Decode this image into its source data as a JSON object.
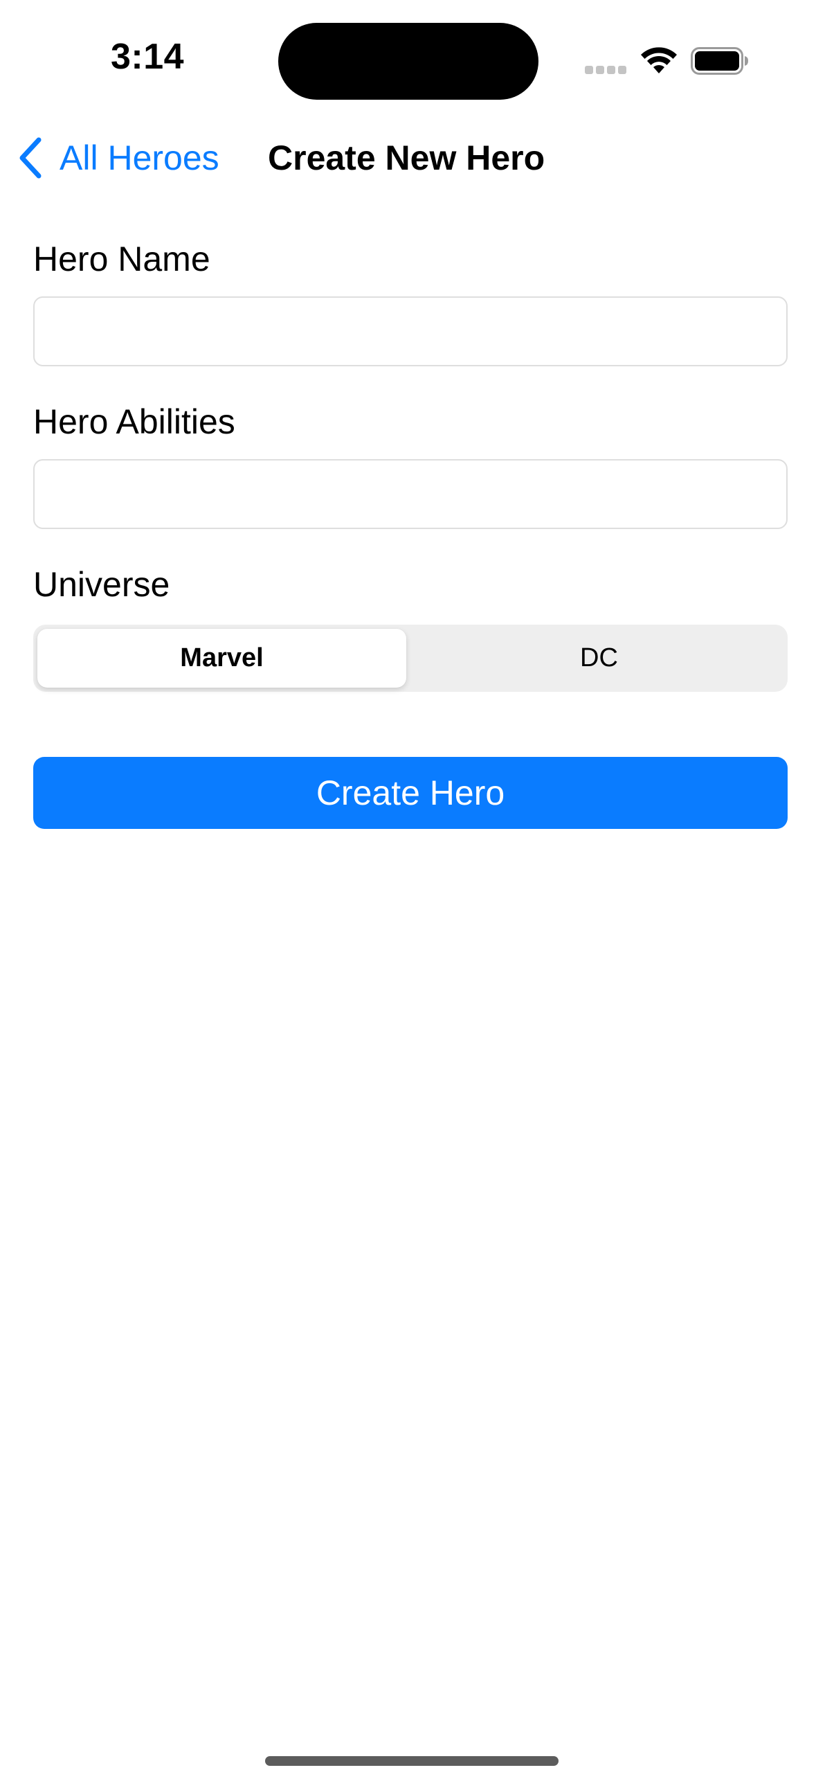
{
  "status_bar": {
    "time": "3:14"
  },
  "nav": {
    "back_label": "All Heroes",
    "title": "Create New Hero"
  },
  "form": {
    "hero_name": {
      "label": "Hero Name",
      "value": "",
      "placeholder": ""
    },
    "hero_abilities": {
      "label": "Hero Abilities",
      "value": "",
      "placeholder": ""
    },
    "universe": {
      "label": "Universe",
      "options": [
        "Marvel",
        "DC"
      ],
      "selected": "Marvel"
    },
    "submit_label": "Create Hero"
  },
  "colors": {
    "accent": "#0a7cff",
    "segmented_bg": "#eeeeee",
    "field_border": "#dedede"
  },
  "icons": {
    "back": "chevron-left-icon",
    "wifi": "wifi-icon",
    "battery": "battery-icon",
    "signal": "cellular-signal-icon"
  }
}
